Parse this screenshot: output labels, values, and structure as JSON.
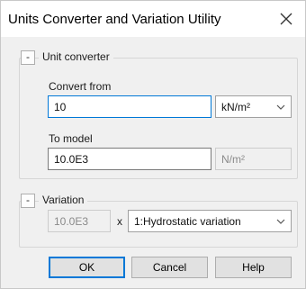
{
  "window": {
    "title": "Units Converter and Variation Utility"
  },
  "unit_converter": {
    "toggle_symbol": "-",
    "legend": "Unit converter",
    "convert_from": {
      "label": "Convert from",
      "value": "10",
      "unit": "kN/m²"
    },
    "to_model": {
      "label": "To model",
      "value": "10.0E3",
      "unit": "N/m²"
    }
  },
  "variation": {
    "toggle_symbol": "-",
    "legend": "Variation",
    "value": "10.0E3",
    "multiply_symbol": "x",
    "selected_option": "1:Hydrostatic variation"
  },
  "buttons": {
    "ok": "OK",
    "cancel": "Cancel",
    "help": "Help"
  },
  "icons": {
    "close": "close-icon",
    "dropdown": "chevron-down-icon"
  }
}
